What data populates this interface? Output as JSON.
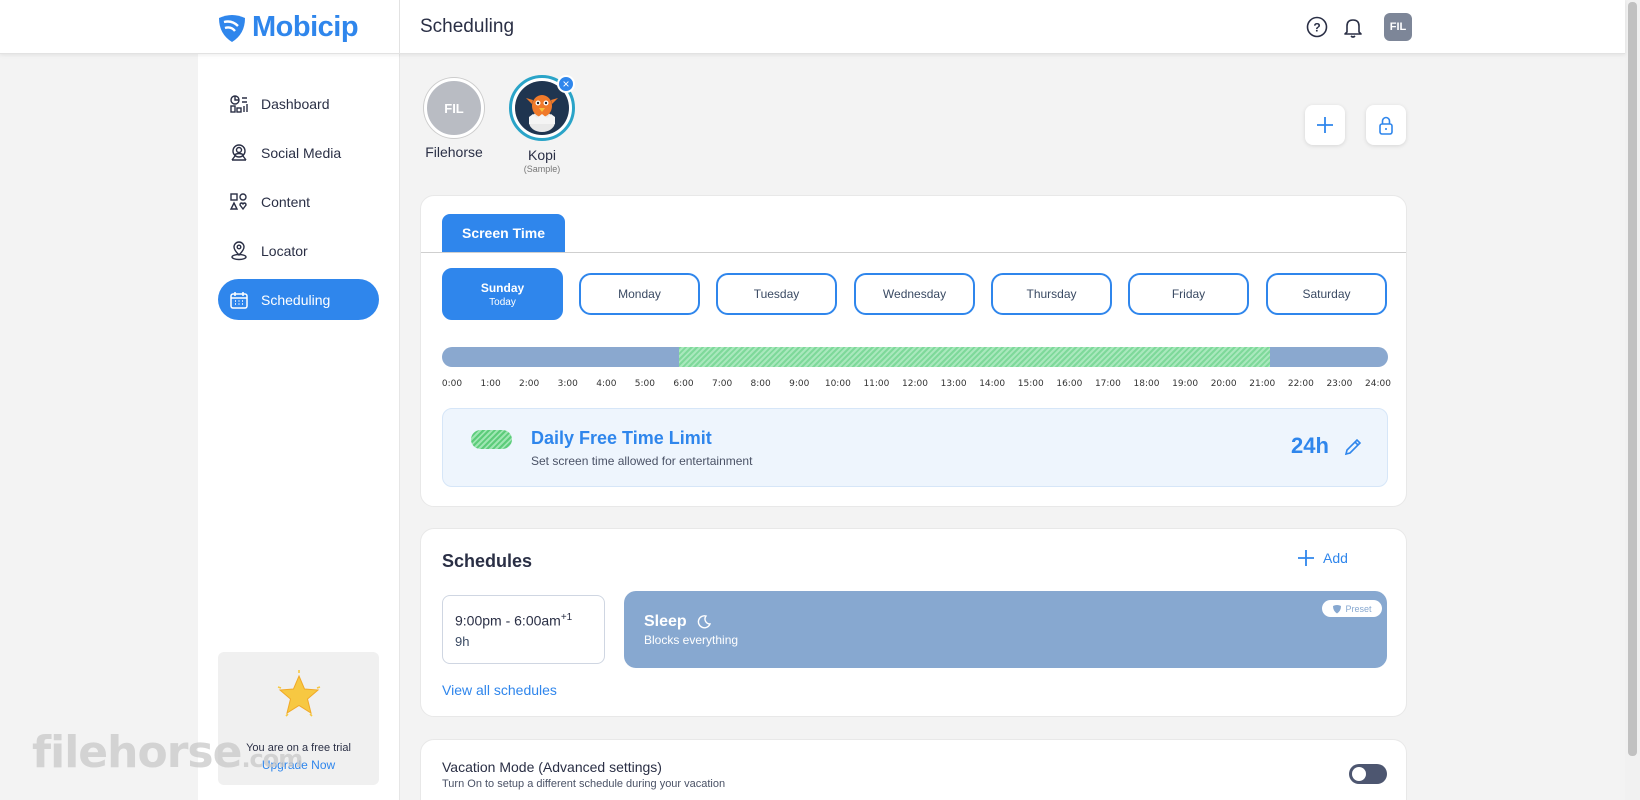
{
  "app": {
    "name": "Mobicip",
    "page_title": "Scheduling"
  },
  "header": {
    "icons": [
      "help-icon",
      "bell-icon"
    ],
    "avatar": "FIL"
  },
  "sidebar": {
    "items": [
      {
        "label": "Dashboard",
        "icon": "dashboard-icon"
      },
      {
        "label": "Social Media",
        "icon": "social-media-icon"
      },
      {
        "label": "Content",
        "icon": "content-icon"
      },
      {
        "label": "Locator",
        "icon": "locator-icon"
      },
      {
        "label": "Scheduling",
        "icon": "calendar-icon",
        "active": true
      }
    ],
    "trial": {
      "text": "You are on a free trial",
      "link": "Upgrade Now"
    }
  },
  "profiles": [
    {
      "initials": "FIL",
      "name": "Filehorse"
    },
    {
      "name": "Kopi",
      "sub": "(Sample)"
    }
  ],
  "screen_time": {
    "tab": "Screen Time",
    "days": [
      {
        "label": "Sunday",
        "sub": "Today",
        "active": true
      },
      {
        "label": "Monday"
      },
      {
        "label": "Tuesday"
      },
      {
        "label": "Wednesday"
      },
      {
        "label": "Thursday"
      },
      {
        "label": "Friday"
      },
      {
        "label": "Saturday"
      }
    ],
    "free_time_range_hours": [
      6,
      21
    ],
    "ticks": [
      "0:00",
      "1:00",
      "2:00",
      "3:00",
      "4:00",
      "5:00",
      "6:00",
      "7:00",
      "8:00",
      "9:00",
      "10:00",
      "11:00",
      "12:00",
      "13:00",
      "14:00",
      "15:00",
      "16:00",
      "17:00",
      "18:00",
      "19:00",
      "20:00",
      "21:00",
      "22:00",
      "23:00",
      "24:00"
    ],
    "limit": {
      "title": "Daily Free Time Limit",
      "subtitle": "Set screen time allowed for entertainment",
      "value": "24h"
    }
  },
  "schedules": {
    "title": "Schedules",
    "add_label": "Add",
    "items": [
      {
        "range": "9:00pm - 6:00am",
        "sup": "+1",
        "duration": "9h",
        "name": "Sleep",
        "desc": "Blocks everything",
        "badge": "Preset"
      }
    ],
    "view_all": "View all schedules"
  },
  "vacation": {
    "title": "Vacation Mode (Advanced settings)",
    "subtitle": "Turn On to setup a different schedule during your vacation",
    "enabled": false
  },
  "watermark": {
    "text": "filehorse",
    "suffix": ".com"
  },
  "colors": {
    "accent": "#2f86ec",
    "bar": "#8aa8cf",
    "free": "#7ed99a"
  }
}
